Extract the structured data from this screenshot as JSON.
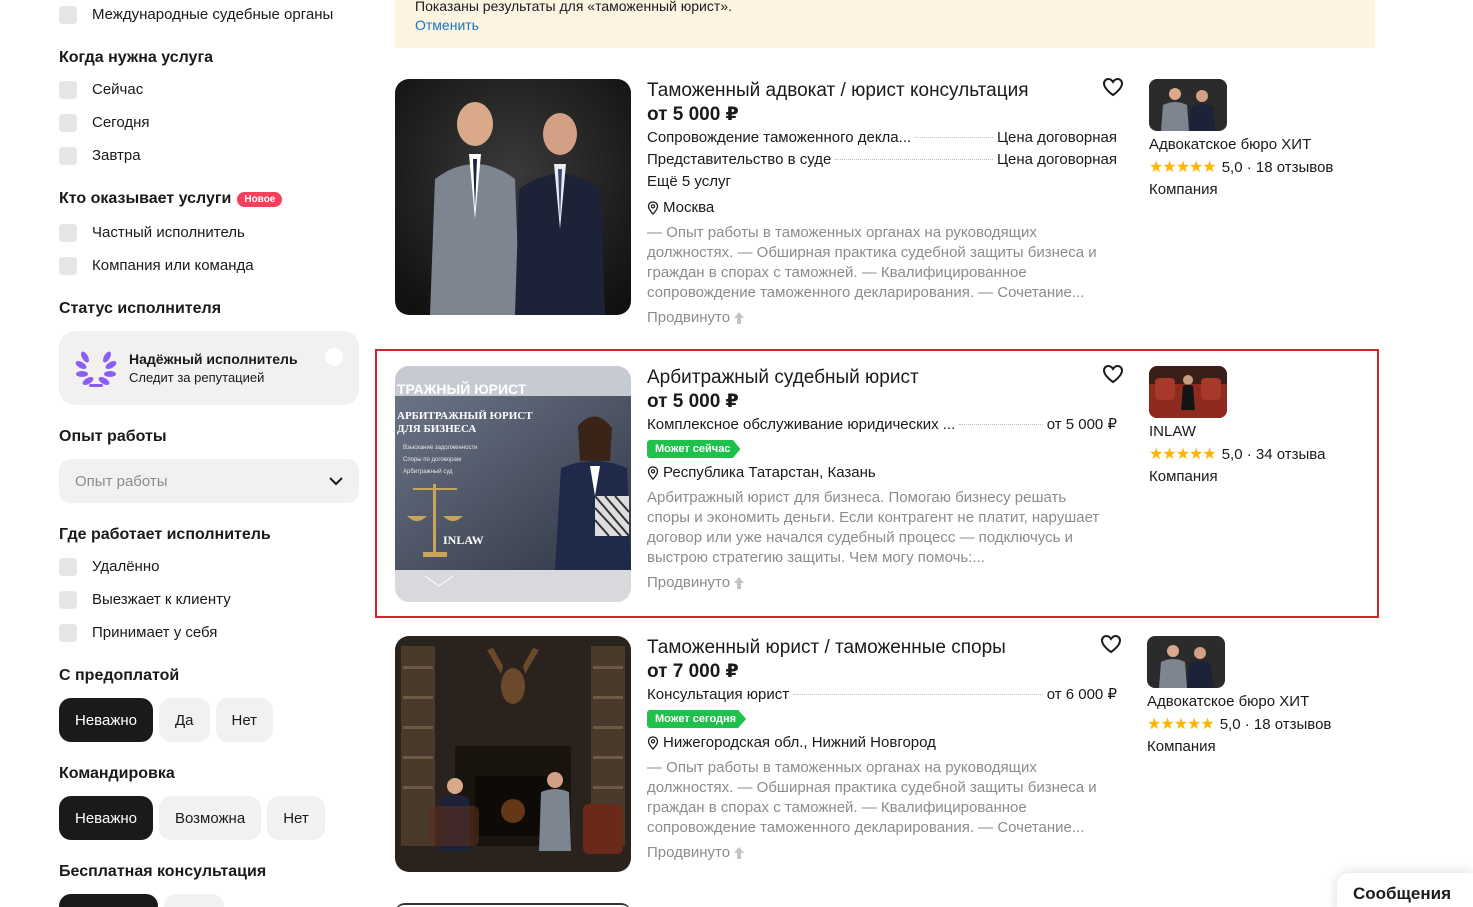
{
  "sidebar": {
    "court_item": "Международные судебные органы",
    "when": {
      "title": "Когда нужна услуга",
      "options": [
        "Сейчас",
        "Сегодня",
        "Завтра"
      ]
    },
    "who": {
      "title": "Кто оказывает услуги",
      "badge": "Новое",
      "options": [
        "Частный исполнитель",
        "Компания или команда"
      ]
    },
    "status": {
      "title": "Статус исполнителя",
      "card_title": "Надёжный исполнитель",
      "card_sub": "Следит за репутацией"
    },
    "experience": {
      "title": "Опыт работы",
      "placeholder": "Опыт работы"
    },
    "where": {
      "title": "Где работает исполнитель",
      "options": [
        "Удалённо",
        "Выезжает к клиенту",
        "Принимает у себя"
      ]
    },
    "prepay": {
      "title": "С предоплатой",
      "options": [
        "Неважно",
        "Да",
        "Нет"
      ],
      "selected": "Неважно"
    },
    "trip": {
      "title": "Командировка",
      "options": [
        "Неважно",
        "Возможна",
        "Нет"
      ],
      "selected": "Неважно"
    },
    "free_consult": {
      "title": "Бесплатная консультация"
    }
  },
  "notice": {
    "text": "Показаны результаты для «таможенный юрист».",
    "cancel": "Отменить"
  },
  "listings": [
    {
      "title": "Таможенный адвокат / юрист консультация",
      "price": "от 5 000 ₽",
      "services": [
        {
          "name": "Сопровождение таможенного декла...",
          "value": "Цена договорная"
        },
        {
          "name": "Представительство в суде",
          "value": "Цена договорная"
        }
      ],
      "more": "Ещё 5 услуг",
      "tag": "",
      "location": "Москва",
      "description": "— Опыт работы в таможенных органах на руководящих должностях. — Обширная практика судебной защиты бизнеса и граждан в спорах с таможней. — Квалифицированное сопровождение таможенного декларирования. — Сочетание...",
      "promo": "Продвинуто",
      "seller": {
        "name": "Адвокатское бюро ХИТ",
        "stars": "★★★★★",
        "rating": "5,0 · 18 отзывов",
        "type": "Компания"
      }
    },
    {
      "title": "Арбитражный судебный юрист",
      "price": "от 5 000 ₽",
      "services": [
        {
          "name": "Комплексное обслуживание юридических ...",
          "value": "от 5 000 ₽"
        }
      ],
      "more": "",
      "tag": "Может сейчас",
      "location": "Республика Татарстан, Казань",
      "description": "Арбитражный юрист для бизнеса. Помогаю бизнесу решать споры и экономить деньги. Если контрагент не платит, нарушает договор или уже начался судебный процесс — подключусь и выстрою стратегию защиты. Чем могу помочь:...",
      "promo": "Продвинуто",
      "photo_text": {
        "banner": "ТРАЖНЫЙ ЮРИСТ",
        "heading_1": "АРБИТРАЖНЫЙ ЮРИСТ",
        "heading_2": "ДЛЯ БИЗНЕСА",
        "bullets": [
          "Взыскание задолженности",
          "Споры по договорам",
          "Арбитражный суд"
        ],
        "logo": "INLAW"
      },
      "seller": {
        "name": "INLAW",
        "stars": "★★★★★",
        "rating": "5,0 · 34 отзыва",
        "type": "Компания"
      }
    },
    {
      "title": "Таможенный юрист / таможенные споры",
      "price": "от 7 000 ₽",
      "services": [
        {
          "name": "Консультация юрист",
          "value": "от 6 000 ₽"
        }
      ],
      "more": "",
      "tag": "Может сегодня",
      "location": "Нижегородская обл., Нижний Новгород",
      "description": "— Опыт работы в таможенных органах на руководящих должностях. — Обширная практика судебной защиты бизнеса и граждан в спорах с таможней. — Квалифицированное сопровождение таможенного декларирования. — Сочетание...",
      "promo": "Продвинуто",
      "seller": {
        "name": "Адвокатское бюро ХИТ",
        "stars": "★★★★★",
        "rating": "5,0 · 18 отзывов",
        "type": "Компания"
      }
    }
  ],
  "messages_button": "Сообщения",
  "colors": {
    "accent_red": "#d0262a",
    "tag_green": "#1fc04b",
    "star": "#ffb400",
    "link": "#1778c8",
    "notice_bg": "#fdf3e1"
  }
}
